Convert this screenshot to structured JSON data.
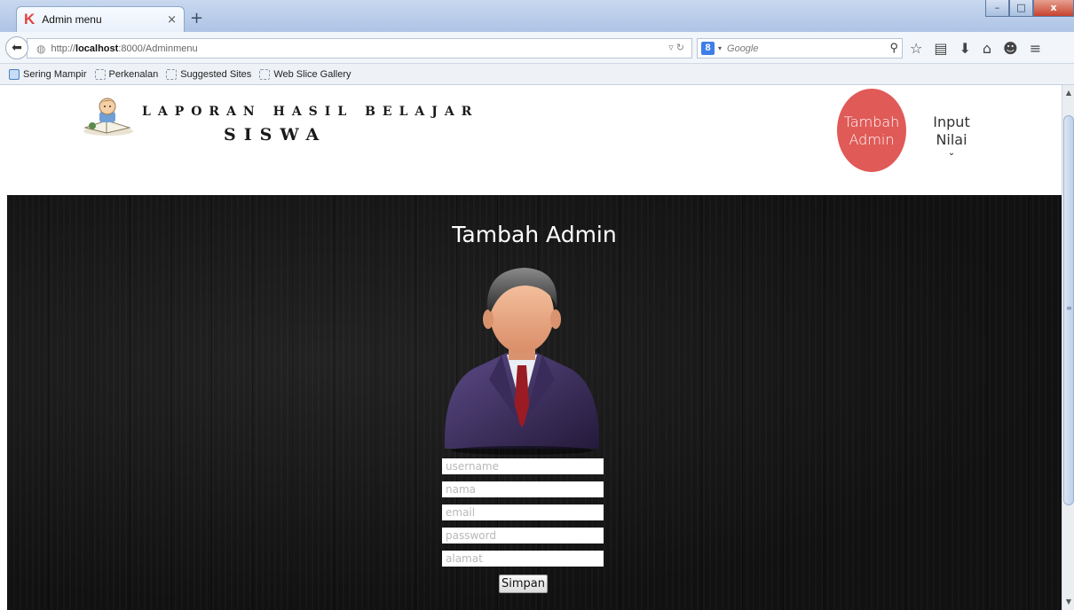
{
  "browser": {
    "tab_title": "Admin menu",
    "tab_close": "×",
    "new_tab": "+",
    "url_prefix": "http://",
    "url_host": "localhost",
    "url_path": ":8000/Adminmenu",
    "search_engine": "8",
    "search_placeholder": "Google",
    "window_buttons": [
      "–",
      "□",
      "x"
    ]
  },
  "bookmarks": [
    "Sering Mampir",
    "Perkenalan",
    "Suggested Sites",
    "Web Slice Gallery"
  ],
  "site": {
    "title_line1": "LAPORAN HASIL BELAJAR",
    "title_line2": "SISWA",
    "nav": [
      {
        "label_line1": "Tambah",
        "label_line2": "Admin"
      },
      {
        "label_line1": "Input",
        "label_line2": "Nilai",
        "caret": "⌄"
      }
    ]
  },
  "form": {
    "title": "Tambah Admin",
    "fields": [
      {
        "placeholder": "username"
      },
      {
        "placeholder": "nama"
      },
      {
        "placeholder": "email"
      },
      {
        "placeholder": "password"
      },
      {
        "placeholder": "alamat"
      }
    ],
    "submit_label": "Simpan"
  },
  "colors": {
    "nav_active": "#e05a57",
    "page_background": "#141414"
  }
}
